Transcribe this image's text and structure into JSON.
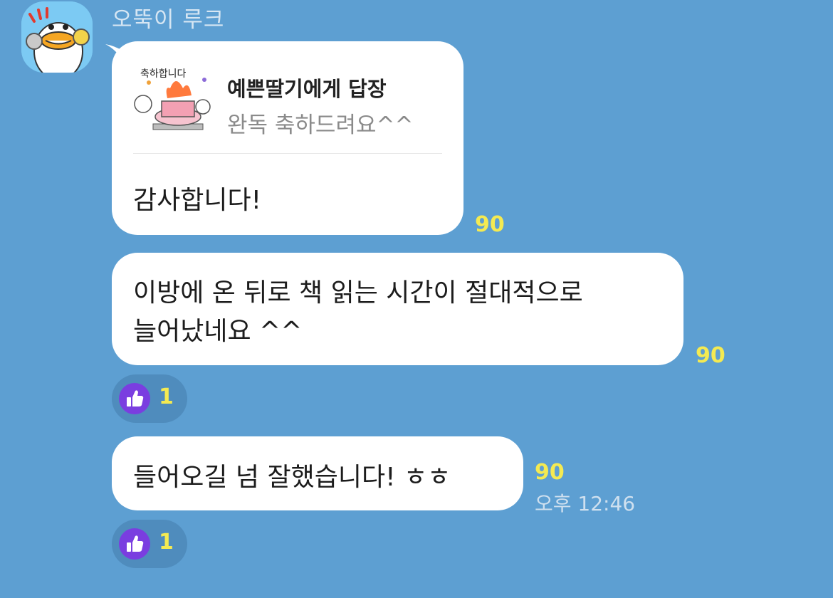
{
  "sender_name": "오뚝이 루크",
  "messages": [
    {
      "reply": {
        "sticker_text": "축하합니다",
        "title": "예쁜딸기에게 답장",
        "quoted": "완독 축하드려요^^"
      },
      "text": "감사합니다!",
      "unread": "90"
    },
    {
      "text": "이방에 온 뒤로 책 읽는 시간이 절대적으로\n늘어났네요 ^^",
      "unread": "90",
      "reaction_count": "1"
    },
    {
      "text": "들어오길 넘 잘했습니다! ㅎㅎ",
      "unread": "90",
      "time": "오후 12:46",
      "reaction_count": "1"
    }
  ],
  "colors": {
    "background": "#5d9fd2",
    "bubble": "#ffffff",
    "unread": "#f4ea52",
    "reaction_badge": "#7a3ee0"
  },
  "icons": [
    "duck-avatar-icon",
    "celebration-sticker-icon",
    "thumbs-up-icon"
  ]
}
